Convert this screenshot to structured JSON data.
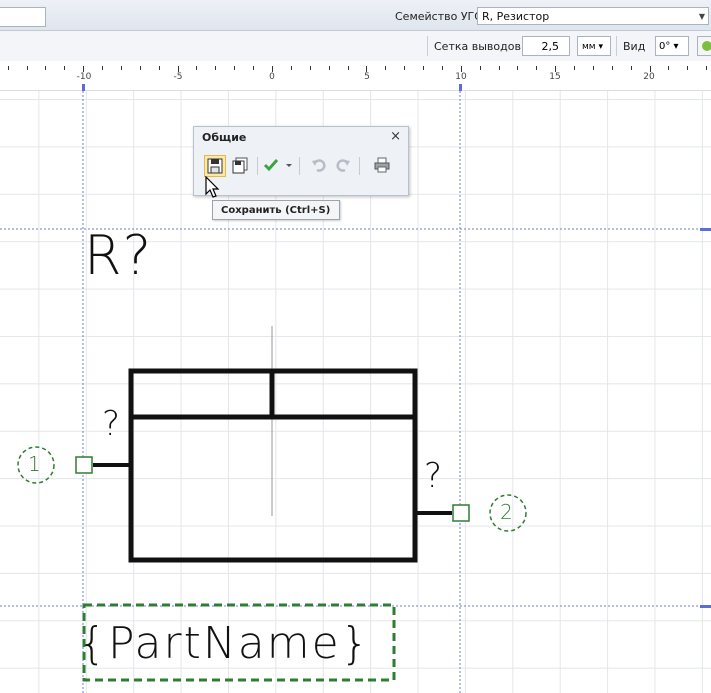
{
  "top_bar": {
    "family_label": "Семейство УГО",
    "family_value": "R, Резистор"
  },
  "toolbar": {
    "grid_label": "Сетка выводов",
    "grid_value": "2,5",
    "unit": "мм",
    "view_label": "Вид",
    "angle": "0°"
  },
  "ruler": {
    "labels": [
      "-10",
      "-5",
      "0",
      "5",
      "10",
      "15",
      "20"
    ]
  },
  "panel": {
    "title": "Общие",
    "close": "×",
    "tooltip": "Сохранить (Ctrl+S)"
  },
  "symbol": {
    "designator": "R?",
    "part_name": "{PartName}",
    "pin1_number": "1",
    "pin2_number": "2",
    "pin1_label": "?",
    "pin2_label": "?"
  },
  "colors": {
    "pin_green": "#2e7d32",
    "guide_blue": "#5b6ed8",
    "selection_yellow": "#fbe9a8"
  }
}
